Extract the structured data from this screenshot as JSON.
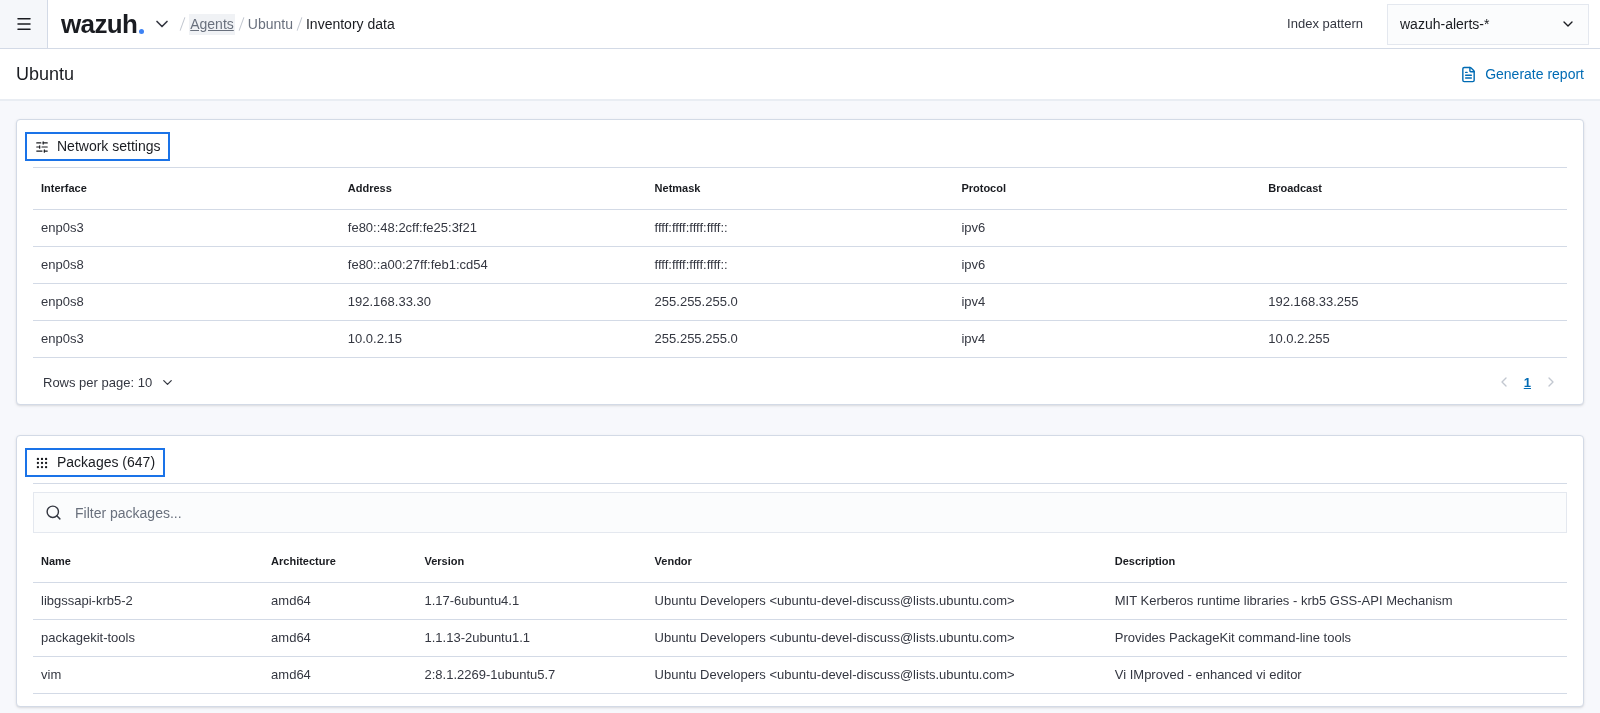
{
  "header": {
    "logo": "wazuh",
    "breadcrumbs": [
      {
        "label": "Agents",
        "kind": "link"
      },
      {
        "label": "Ubuntu",
        "kind": "plain"
      },
      {
        "label": "Inventory data",
        "kind": "current"
      }
    ],
    "index_pattern": {
      "label": "Index pattern",
      "value": "wazuh-alerts-*"
    }
  },
  "page": {
    "title": "Ubuntu",
    "action": "Generate report"
  },
  "network": {
    "title": "Network settings",
    "columns": [
      "Interface",
      "Address",
      "Netmask",
      "Protocol",
      "Broadcast"
    ],
    "rows": [
      [
        "enp0s3",
        "fe80::48:2cff:fe25:3f21",
        "ffff:ffff:ffff:ffff::",
        "ipv6",
        ""
      ],
      [
        "enp0s8",
        "fe80::a00:27ff:feb1:cd54",
        "ffff:ffff:ffff:ffff::",
        "ipv6",
        ""
      ],
      [
        "enp0s8",
        "192.168.33.30",
        "255.255.255.0",
        "ipv4",
        "192.168.33.255"
      ],
      [
        "enp0s3",
        "10.0.2.15",
        "255.255.255.0",
        "ipv4",
        "10.0.2.255"
      ]
    ],
    "rows_per_page": "Rows per page: 10",
    "pages": [
      {
        "label": "1",
        "selected": true
      }
    ]
  },
  "packages": {
    "title": "Packages (647)",
    "filter": {
      "placeholder": "Filter packages..."
    },
    "columns": [
      "Name",
      "Architecture",
      "Version",
      "Vendor",
      "Description"
    ],
    "rows": [
      [
        "libgssapi-krb5-2",
        "amd64",
        "1.17-6ubuntu4.1",
        "Ubuntu Developers <ubuntu-devel-discuss@lists.ubuntu.com>",
        "MIT Kerberos runtime libraries - krb5 GSS-API Mechanism"
      ],
      [
        "packagekit-tools",
        "amd64",
        "1.1.13-2ubuntu1.1",
        "Ubuntu Developers <ubuntu-devel-discuss@lists.ubuntu.com>",
        "Provides PackageKit command-line tools"
      ],
      [
        "vim",
        "amd64",
        "2:8.1.2269-1ubuntu5.7",
        "Ubuntu Developers <ubuntu-devel-discuss@lists.ubuntu.com>",
        "Vi IMproved - enhanced vi editor"
      ]
    ]
  }
}
